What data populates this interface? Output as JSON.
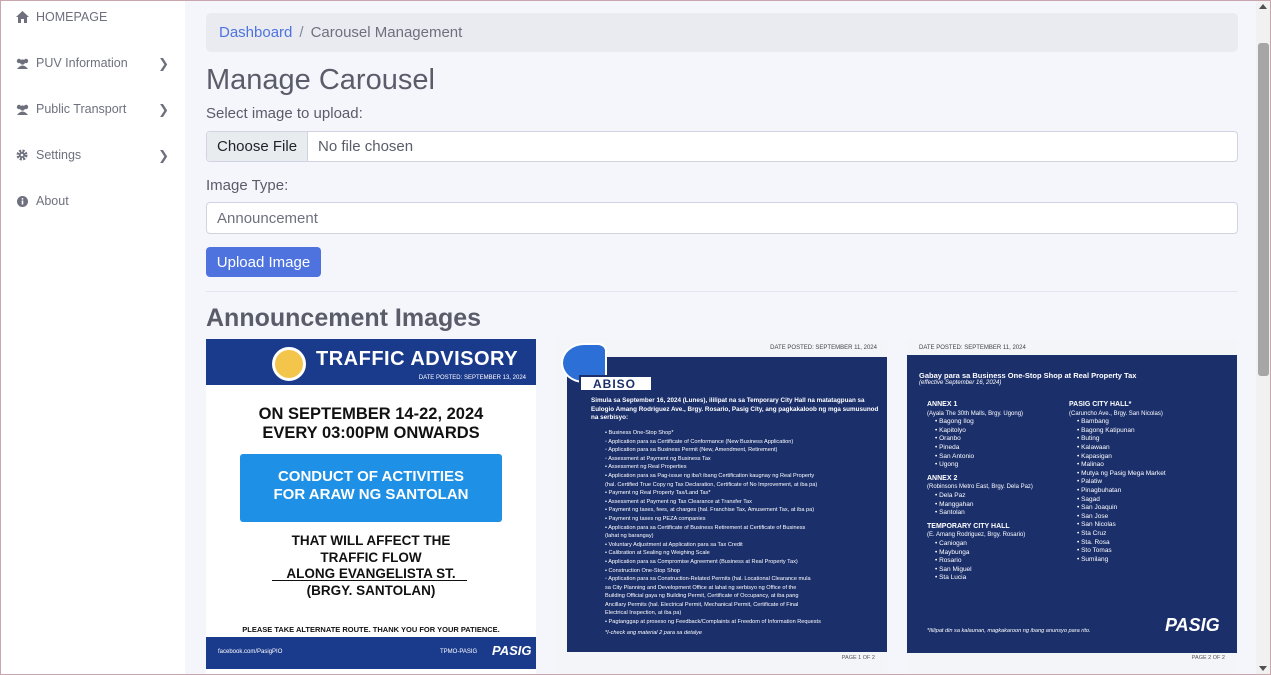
{
  "sidebar": {
    "items": [
      {
        "label": "HOMEPAGE",
        "icon": "home-icon",
        "has_chevron": false
      },
      {
        "label": "PUV Information",
        "icon": "users-icon",
        "has_chevron": true
      },
      {
        "label": "Public Transport",
        "icon": "users-icon",
        "has_chevron": true
      },
      {
        "label": "Settings",
        "icon": "gear-icon",
        "has_chevron": true
      },
      {
        "label": "About",
        "icon": "info-icon",
        "has_chevron": false
      }
    ]
  },
  "breadcrumb": {
    "link": "Dashboard",
    "separator": "/",
    "current": "Carousel Management"
  },
  "page_title": "Manage Carousel",
  "upload_form": {
    "select_label": "Select image to upload:",
    "choose_file": "Choose File",
    "no_file": "No file chosen",
    "type_label": "Image Type:",
    "type_value": "Announcement",
    "upload_button": "Upload Image"
  },
  "section_title": "Announcement Images",
  "colors": {
    "primary": "#4e73df",
    "navy": "#1b2f6b",
    "advisory_blue": "#1e90e6"
  },
  "cards": {
    "advisory": {
      "title": "TRAFFIC ADVISORY",
      "date": "DATE POSTED: SEPTEMBER 13, 2024",
      "line1": "ON SEPTEMBER 14-22, 2024",
      "line2": "EVERY 03:00PM ONWARDS",
      "box1": "CONDUCT OF ACTIVITIES",
      "box2": "FOR ARAW NG SANTOLAN",
      "affect1": "THAT WILL AFFECT THE",
      "affect2": "TRAFFIC FLOW",
      "affect3": "ALONG EVANGELISTA ST.",
      "affect4": "(BRGY. SANTOLAN)",
      "alternate": "PLEASE TAKE ALTERNATE ROUTE. THANK YOU FOR YOUR PATIENCE.",
      "facebook": "facebook.com/PasigPIO",
      "tpmo": "TPMO-PASIG",
      "pasig": "PASIG"
    },
    "abiso": {
      "date": "DATE POSTED: SEPTEMBER 11, 2024",
      "title": "ABISO",
      "intro": "Simula sa September 16, 2024 (Lunes), ililipat na sa Temporary City Hall na matatagpuan sa Eulogio Amang Rodriguez Ave., Brgy. Rosario, Pasig City, ang pagkakaloob ng mga sumusunod na serbisyo:",
      "items": [
        "• Business One-Stop Shop*",
        "    ◦ Application para sa Certificate of Conformance (New Business Application)",
        "    ◦ Application para sa Business Permit (New, Amendment, Retirement)",
        "    ◦ Assessment at Payment ng Business Tax",
        "• Assessment ng Real Properties",
        "• Application para sa Pag-issue ng iba't ibang Certification kaugnay ng Real Property",
        "  (hal. Certified True Copy ng Tax Declaration, Certificate of No Improvement, at iba pa)",
        "• Payment ng Real Property Tax/Land Tax*",
        "• Assessment at Payment ng Tax Clearance at Transfer Tax",
        "• Payment ng taxes, fees, at charges (hal. Franchise Tax, Amusement Tax, at iba pa)",
        "• Payment ng taxes ng PEZA companies",
        "• Application para sa Certificate of Business Retirement at Certificate of Business",
        "  (lahat ng barangay)",
        "• Voluntary Adjustment at Application para sa Tax Credit",
        "• Calibration at Sealing ng Weighing Scale",
        "• Application para sa Compromise Agreement (Business at Real Property Tax)",
        "• Construction One-Stop Shop",
        "    ◦ Application para sa Construction-Related Permits (hal. Locational Clearance mula",
        "      sa City Planning and Development Office at lahat ng serbisyo ng Office of the",
        "      Building Official gaya ng Building Permit, Certificate of Occupancy, at iba pang",
        "      Ancillary Permits (hal. Electrical Permit, Mechanical Permit, Certificate of Final",
        "      Electrical Inspection, at iba pa)",
        "• Pagtanggap at proseso ng Feedback/Complaints at Freedom of Information Requests"
      ],
      "note": "*I-check ang material 2 para sa detalye",
      "page": "PAGE 1 OF 2"
    },
    "gabay": {
      "date": "DATE POSTED: SEPTEMBER 11, 2024",
      "title": "Gabay para sa Business One-Stop Shop at Real Property Tax",
      "subtitle": "(effective September 16, 2024)",
      "annex1": {
        "title": "ANNEX 1",
        "sub": "(Ayala The 30th Malls, Brgy. Ugong)",
        "items": [
          "Bagong Ilog",
          "Kapitolyo",
          "Oranbo",
          "Pineda",
          "San Antonio",
          "Ugong"
        ]
      },
      "annex2": {
        "title": "ANNEX 2",
        "sub": "(Robinsons Metro East, Brgy. Dela Paz)",
        "items": [
          "Dela Paz",
          "Manggahan",
          "Santolan"
        ]
      },
      "temp": {
        "title": "TEMPORARY CITY HALL",
        "sub": "(E. Amang Rodriguez, Brgy. Rosario)",
        "items": [
          "Caniogan",
          "Maybunga",
          "Rosario",
          "San Miguel",
          "Sta Lucia"
        ]
      },
      "cityhall": {
        "title": "PASIG CITY HALL*",
        "sub": "(Caruncho Ave., Brgy. San Nicolas)",
        "items": [
          "Bambang",
          "Bagong Katipunan",
          "Buting",
          "Kalawaan",
          "Kapasigan",
          "Malinao",
          "Mutya ng Pasig Mega Market",
          "Palatiw",
          "Pinagbuhatan",
          "Sagad",
          "San Joaquin",
          "San Jose",
          "San Nicolas",
          "Sta Cruz",
          "Sta. Rosa",
          "Sto Tomas",
          "Sumilang"
        ]
      },
      "note": "*Ililipat din sa kalaunan, magkakaroon ng ibang anunsyo para rito.",
      "pasig": "PASIG",
      "page": "PAGE 2 OF 2"
    }
  }
}
